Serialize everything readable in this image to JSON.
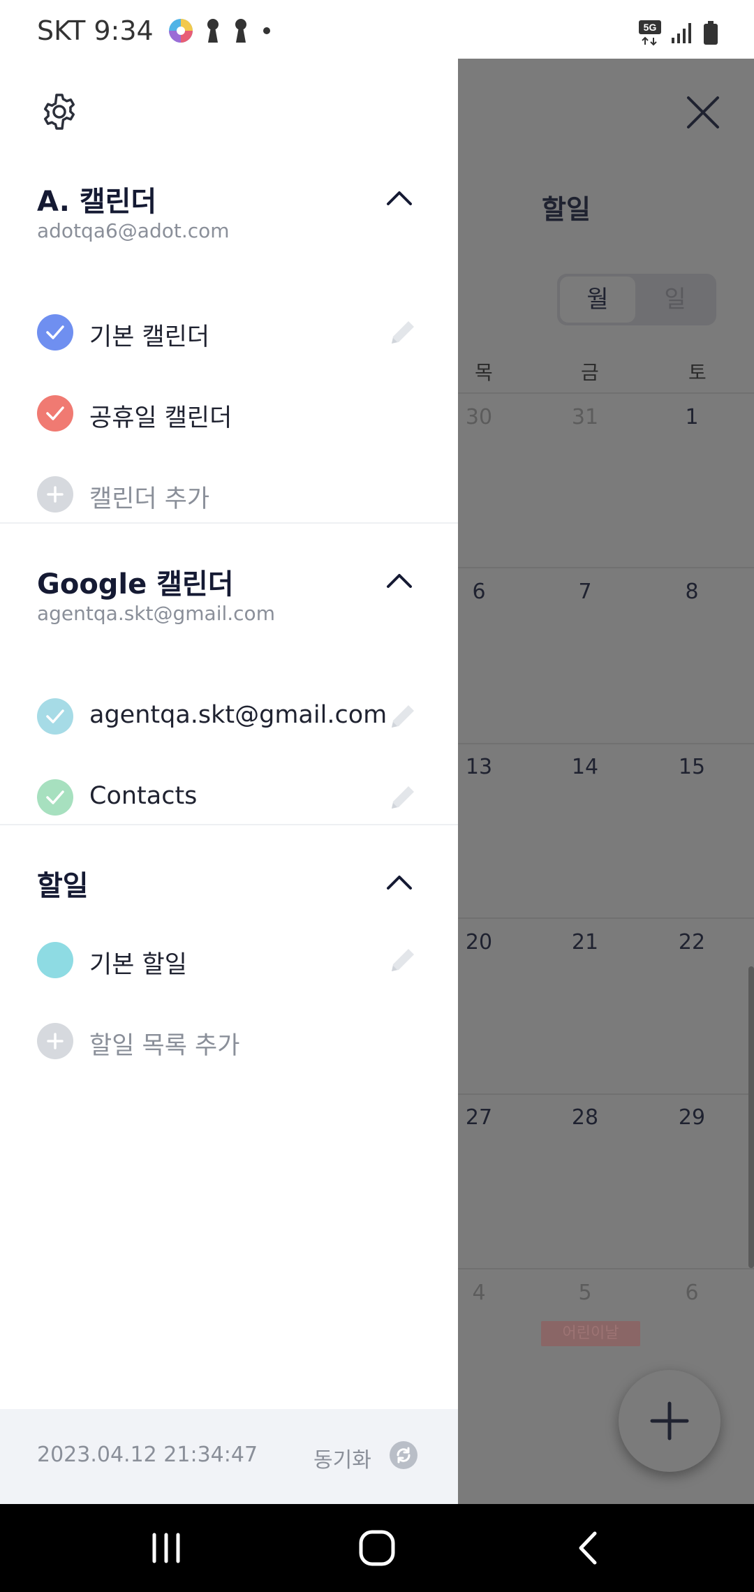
{
  "status_bar": {
    "carrier_time": "SKT 9:34",
    "network": "5G",
    "icons": [
      "color-wheel-icon",
      "keyhole-icon",
      "keyhole-icon",
      "dot-icon",
      "5g-icon",
      "signal-icon",
      "battery-icon"
    ]
  },
  "drawer": {
    "settings_icon": "gear-icon",
    "sections": [
      {
        "title": "A. 캘린더",
        "subtitle": "adotqa6@adot.com",
        "items": [
          {
            "label": "기본 캘린더",
            "color": "#6f8ff0",
            "checked": true,
            "editable": true
          },
          {
            "label": "공휴일 캘린더",
            "color": "#f07a72",
            "checked": true,
            "editable": false
          },
          {
            "label": "캘린더 추가",
            "color": "#d6d9de",
            "add": true
          }
        ]
      },
      {
        "title": "Google 캘린더",
        "subtitle": "agentqa.skt@gmail.com",
        "items": [
          {
            "label": "agentqa.skt@gmail.com",
            "color": "#a6dbe6",
            "checked": true,
            "editable": true
          },
          {
            "label": "Contacts",
            "color": "#a7e0bf",
            "checked": true,
            "editable": true
          }
        ]
      },
      {
        "title": "할일",
        "subtitle": "",
        "items": [
          {
            "label": "기본 할일",
            "color": "#8edbe3",
            "checked": false,
            "editable": true
          },
          {
            "label": "할일 목록 추가",
            "color": "#d6d9de",
            "add": true
          }
        ]
      }
    ],
    "footer": {
      "last_sync": "2023.04.12 21:34:47",
      "sync_label": "동기화"
    }
  },
  "background_calendar": {
    "title": "할일",
    "view_toggle": {
      "selected": "월",
      "other": "일"
    },
    "weekdays": [
      "목",
      "금",
      "토"
    ],
    "weeks": [
      [
        "30",
        "31",
        "1"
      ],
      [
        "6",
        "7",
        "8"
      ],
      [
        "13",
        "14",
        "15"
      ],
      [
        "20",
        "21",
        "22"
      ],
      [
        "27",
        "28",
        "29"
      ],
      [
        "4",
        "5",
        "6"
      ]
    ],
    "holiday_label": "어린이날"
  },
  "nav_bar": {
    "buttons": [
      "recent-apps-icon",
      "home-icon",
      "back-icon"
    ]
  }
}
